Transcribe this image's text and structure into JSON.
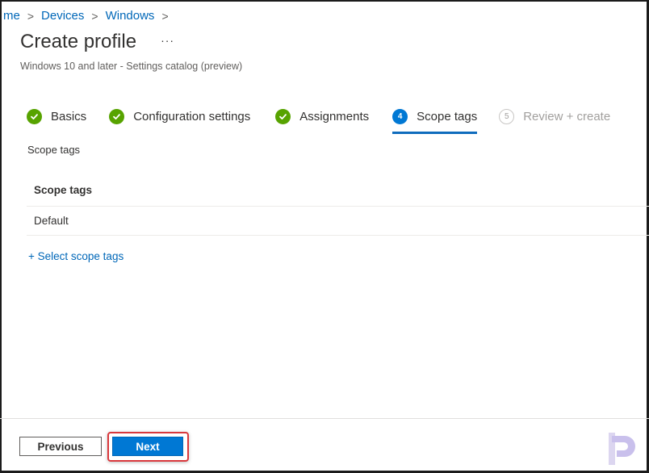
{
  "breadcrumb": {
    "items": [
      "me",
      "Devices",
      "Windows"
    ],
    "separator": ">"
  },
  "header": {
    "title": "Create profile",
    "more_label": "···",
    "subtitle": "Windows 10 and later - Settings catalog (preview)"
  },
  "wizard": {
    "steps": [
      {
        "label": "Basics",
        "state": "completed",
        "marker": "✓"
      },
      {
        "label": "Configuration settings",
        "state": "completed",
        "marker": "✓"
      },
      {
        "label": "Assignments",
        "state": "completed",
        "marker": "✓"
      },
      {
        "label": "Scope tags",
        "state": "current",
        "marker": "4"
      },
      {
        "label": "Review + create",
        "state": "upcoming",
        "marker": "5"
      }
    ]
  },
  "main": {
    "section_label": "Scope tags",
    "table": {
      "header": "Scope tags",
      "rows": [
        "Default"
      ]
    },
    "add_link": "+ Select scope tags"
  },
  "footer": {
    "previous_label": "Previous",
    "next_label": "Next"
  },
  "colors": {
    "accent": "#0078d4",
    "completed": "#57a300",
    "highlight": "#d9383c"
  }
}
